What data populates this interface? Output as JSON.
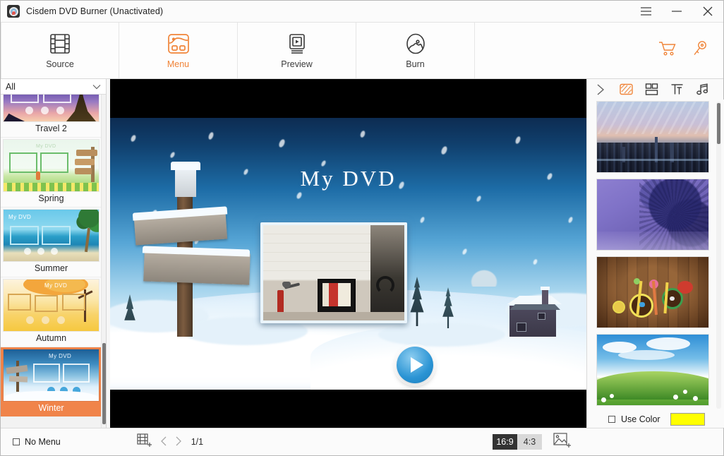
{
  "window": {
    "title": "Cisdem DVD Burner (Unactivated)",
    "app_icon": "dvd-disc-icon",
    "controls": [
      {
        "name": "menu-button",
        "icon": "hamburger-icon"
      },
      {
        "name": "minimize-button",
        "icon": "minimize-icon"
      },
      {
        "name": "close-button",
        "icon": "close-icon"
      }
    ]
  },
  "toolbar": {
    "items": [
      {
        "label": "Source",
        "icon": "film-strip-icon",
        "active": false
      },
      {
        "label": "Menu",
        "icon": "menu-template-icon",
        "active": true
      },
      {
        "label": "Preview",
        "icon": "play-monitor-icon",
        "active": false
      },
      {
        "label": "Burn",
        "icon": "burn-disc-icon",
        "active": false
      }
    ],
    "accent_color": "#f08438",
    "right_icons": [
      {
        "name": "cart-icon",
        "label": "Buy"
      },
      {
        "name": "key-icon",
        "label": "Register"
      }
    ]
  },
  "sidebar": {
    "filter": {
      "value": "All",
      "caret": "chevron-down-icon"
    },
    "themes": [
      {
        "name": "Travel 2",
        "selected": false
      },
      {
        "name": "Spring",
        "selected": false
      },
      {
        "name": "Summer",
        "selected": false
      },
      {
        "name": "Autumn",
        "selected": false
      },
      {
        "name": "Winter",
        "selected": true
      }
    ],
    "selected_highlight": "#f0844a"
  },
  "preview": {
    "menu_title": "My  DVD",
    "play_button": "play-icon",
    "aspect_letterbox": true
  },
  "right_panel": {
    "tabs": [
      {
        "name": "collapse-panel-icon",
        "icon": "chevron-right-icon",
        "active": false
      },
      {
        "name": "background-tab",
        "icon": "background-pattern-icon",
        "active": true
      },
      {
        "name": "layout-tab",
        "icon": "layout-grid-icon",
        "active": false
      },
      {
        "name": "text-tab",
        "icon": "text-format-icon",
        "active": false
      },
      {
        "name": "music-tab",
        "icon": "music-note-icon",
        "active": false
      }
    ],
    "backgrounds": [
      {
        "name": "city-skyline-background"
      },
      {
        "name": "purple-crystals-background"
      },
      {
        "name": "wooden-flowerpots-background"
      },
      {
        "name": "green-hill-background"
      }
    ],
    "use_color": {
      "label": "Use Color",
      "checked": false,
      "color": "#FFFF00"
    }
  },
  "bottom_bar": {
    "no_menu": {
      "label": "No Menu",
      "checked": false
    },
    "add_chapter_icon": "add-film-icon",
    "prev_icon": "chevron-left-icon",
    "next_icon": "chevron-right-icon",
    "page_indicator": "1/1",
    "ratios": [
      {
        "label": "16:9",
        "selected": true
      },
      {
        "label": "4:3",
        "selected": false
      }
    ],
    "add_image_icon": "add-image-icon"
  }
}
